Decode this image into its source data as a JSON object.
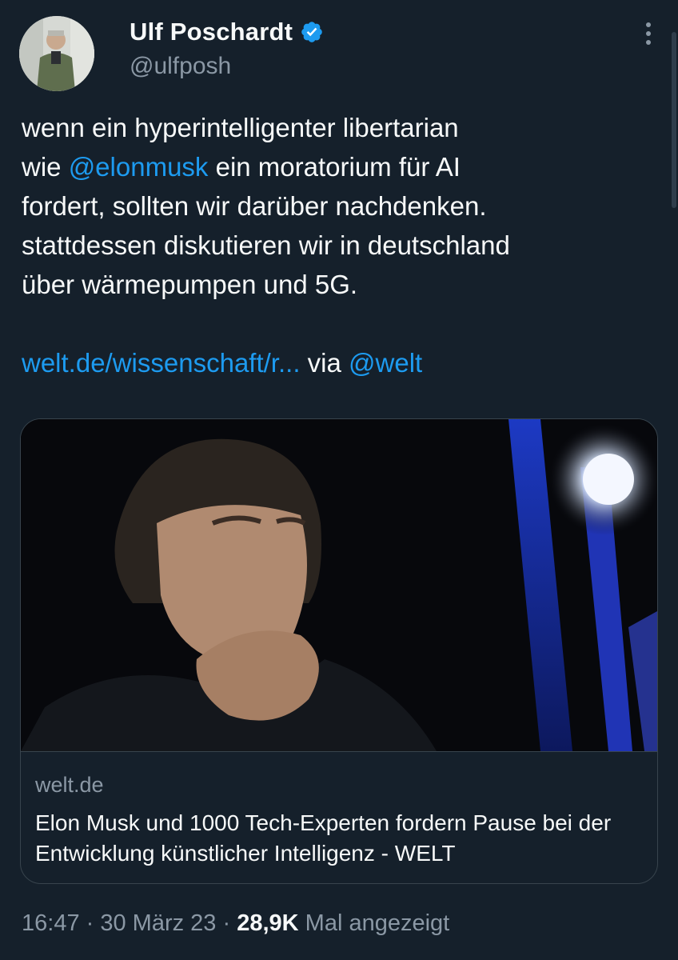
{
  "author": {
    "display_name": "Ulf Poschardt",
    "handle": "@ulfposh",
    "verified_icon": "verified-badge-icon",
    "avatar_icon": "avatar-photo"
  },
  "tweet": {
    "line1": "wenn ein hyperintelligenter libertarian",
    "line2_prefix": "wie ",
    "line2_mention": "@elonmusk",
    "line2_suffix": " ein moratorium für AI",
    "line3": "fordert, sollten wir darüber nachdenken.",
    "line4": "stattdessen diskutieren wir in deutschland",
    "line5": "über wärmepumpen und 5G.",
    "link_text": "welt.de/wissenschaft/r...",
    "via_text": " via ",
    "via_mention": "@welt"
  },
  "card": {
    "domain": "welt.de",
    "title": "Elon Musk und 1000 Tech-Experten fordern Pause bei der Entwicklung künstlicher Intelligenz - WELT"
  },
  "meta": {
    "time": "16:47",
    "separator": " · ",
    "date": "30 März 23",
    "views_count": "28,9K",
    "views_label": " Mal angezeigt"
  },
  "colors": {
    "background": "#15202b",
    "link": "#1d9bf0",
    "secondary_text": "#8b98a5",
    "primary_text": "#f7f9f9",
    "border": "#38444d"
  }
}
